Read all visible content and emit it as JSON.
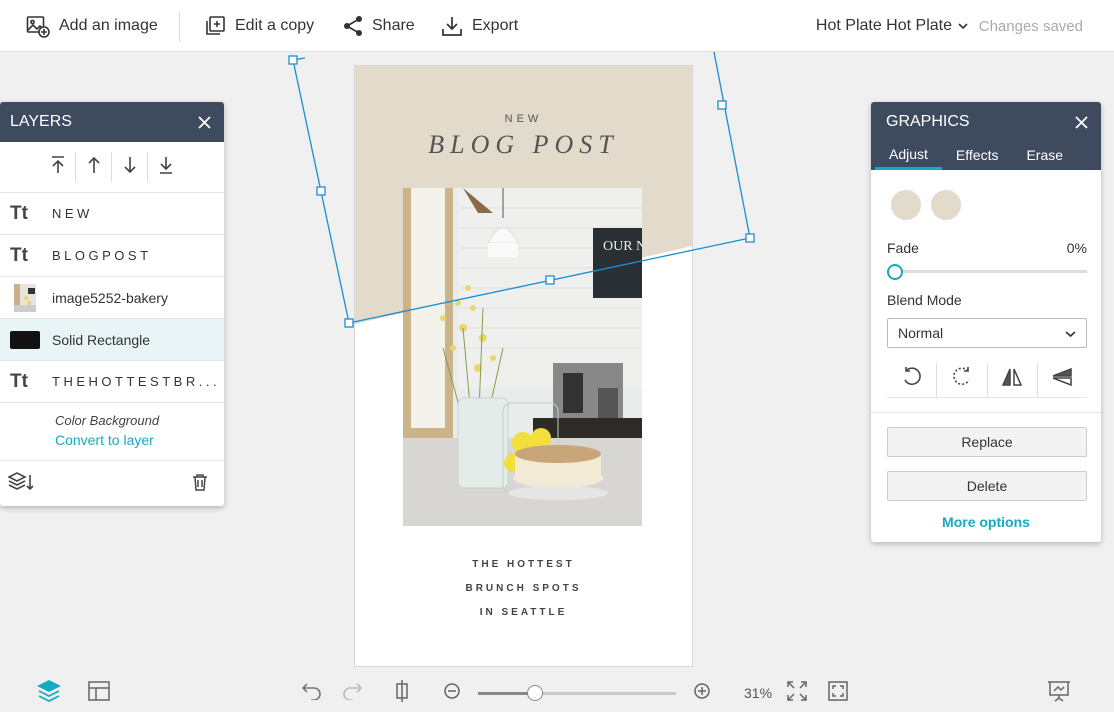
{
  "topbar": {
    "add_image": "Add an image",
    "edit_copy": "Edit a copy",
    "share": "Share",
    "export": "Export",
    "doc_title": "Hot Plate Hot Plate",
    "status": "Changes saved"
  },
  "design": {
    "headline_small": "NEW",
    "headline_large": "BLOG POST",
    "sub_line1": "THE HOTTEST",
    "sub_line2": "BRUNCH SPOTS",
    "sub_line3": "IN SEATTLE",
    "background_color": "#e2dacb"
  },
  "layers": {
    "title": "LAYERS",
    "items": [
      {
        "type": "text",
        "icon": "Tt",
        "label": "NEW"
      },
      {
        "type": "text",
        "icon": "Tt",
        "label": "BLOGPOST"
      },
      {
        "type": "image",
        "label": "image5252-bakery"
      },
      {
        "type": "shape",
        "label": "Solid Rectangle",
        "selected": true
      },
      {
        "type": "text",
        "icon": "Tt",
        "label": "THEHOTTESTBR..."
      }
    ],
    "background_label": "Color Background",
    "convert_link": "Convert to layer"
  },
  "graphics": {
    "title": "GRAPHICS",
    "tabs": [
      "Adjust",
      "Effects",
      "Erase"
    ],
    "active_tab": "Adjust",
    "fade_label": "Fade",
    "fade_value": "0%",
    "fade_fraction": 0,
    "blend_label": "Blend Mode",
    "blend_value": "Normal",
    "replace": "Replace",
    "delete": "Delete",
    "more": "More options",
    "swatch_colors": [
      "#e2dacb",
      "#e2dacb"
    ]
  },
  "bottombar": {
    "zoom": "31%",
    "zoom_fraction": 0.29
  },
  "colors": {
    "accent": "#16a9c3",
    "panel_header": "#3e4a5e",
    "selection": "#1a8fd1"
  }
}
